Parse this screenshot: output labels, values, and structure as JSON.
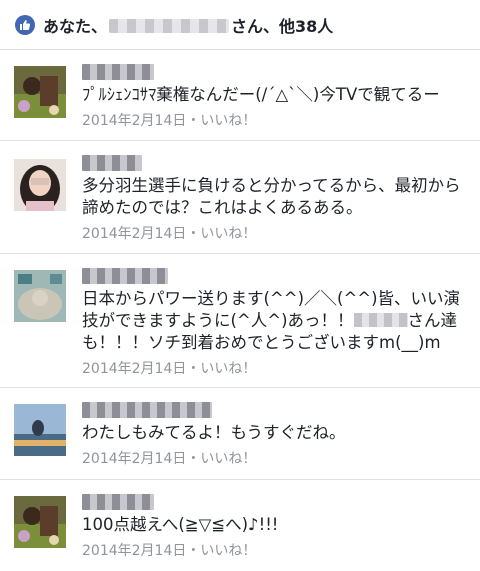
{
  "likes": {
    "prefix": "あなた、",
    "suffix": "さん、他38人",
    "icon": "thumbs-up-icon",
    "accent": "#4267b2"
  },
  "comments": [
    {
      "text": "ﾌﾟﾙｼｪﾝｺｻﾏ棄権なんだー(/´△`＼)今TVで観てるー",
      "date": "2014年2月14日",
      "sep": "・",
      "like": "いいね！"
    },
    {
      "text": "多分羽生選手に負けると分かってるから、最初から諦めたのでは？これはよくあるある。",
      "date": "2014年2月14日",
      "sep": "・",
      "like": "いいね！"
    },
    {
      "text_a": "日本からパワー送ります(^^)／＼(^^)皆、いい演技ができますように(^人^)あっ！！",
      "text_b": "さん達も！！！ソチ到着おめでとうございますm(__)m",
      "date": "2014年2月14日",
      "sep": "・",
      "like": "いいね！"
    },
    {
      "text": "わたしもみてるよ！もうすぐだね。",
      "date": "2014年2月14日",
      "sep": "・",
      "like": "いいね！"
    },
    {
      "text": "100点越えへ(≧▽≦へ)♪!!!",
      "date": "2014年2月14日",
      "sep": "・",
      "like": "いいね！"
    }
  ]
}
